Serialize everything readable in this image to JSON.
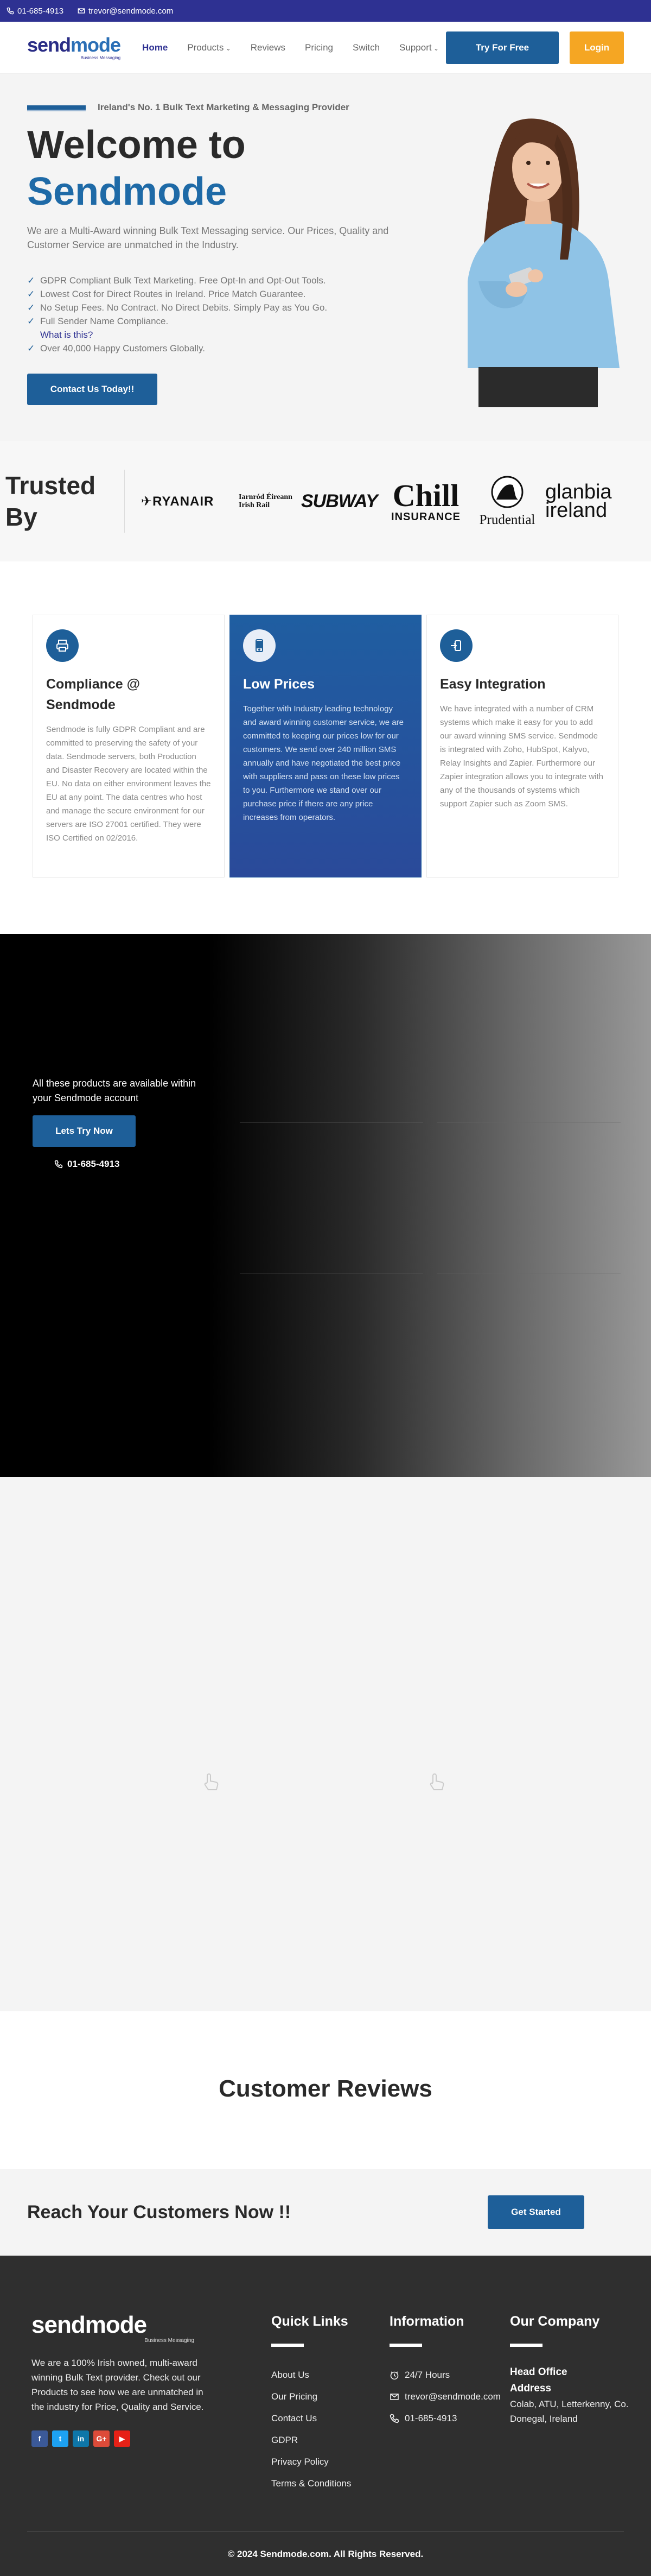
{
  "topbar": {
    "phone": "01-685-4913",
    "email": "trevor@sendmode.com"
  },
  "nav": {
    "logo": {
      "word_a": "send",
      "word_b": "mode",
      "tagline": "Business Messaging"
    },
    "items": [
      {
        "label": "Home",
        "active": true,
        "dropdown": false
      },
      {
        "label": "Products",
        "active": false,
        "dropdown": true
      },
      {
        "label": "Reviews",
        "active": false,
        "dropdown": false
      },
      {
        "label": "Pricing",
        "active": false,
        "dropdown": false
      },
      {
        "label": "Switch",
        "active": false,
        "dropdown": false
      },
      {
        "label": "Support",
        "active": false,
        "dropdown": true
      }
    ],
    "try_label": "Try For Free",
    "login_label": "Login"
  },
  "hero": {
    "subtitle": "Ireland's No. 1 Bulk Text Marketing & Messaging Provider",
    "title_line1": "Welcome to",
    "title_line2": "Sendmode",
    "description": "We are a Multi-Award winning Bulk Text Messaging service. Our Prices, Quality and Customer Service are unmatched in the Industry.",
    "list": [
      "GDPR Compliant Bulk Text Marketing. Free Opt-In and Opt-Out Tools.",
      "Lowest Cost for Direct Routes in Ireland. Price Match Guarantee.",
      "No Setup Fees. No Contract. No Direct Debits. Simply Pay as You Go.",
      "Full Sender Name Compliance.",
      "Over 40,000 Happy Customers Globally."
    ],
    "whatis": "What is this?",
    "contact_label": "Contact Us Today!!"
  },
  "trusted": {
    "title_line1": "Trusted",
    "title_line2": "By",
    "logos": {
      "ryanair": "RYANAIR",
      "irish_rail_1": "Iarnród Éireann",
      "irish_rail_2": "Irish Rail",
      "subway": "SUBWAY",
      "chill_1": "Chill",
      "chill_2": "INSURANCE",
      "prudential": "Prudential",
      "glanbia_1": "glanbia",
      "glanbia_2": "ireland"
    }
  },
  "features": [
    {
      "title": "Compliance @ Sendmode",
      "text": "Sendmode is fully GDPR Compliant and are committed to preserving the safety of your data. Sendmode servers, both Production and Disaster Recovery are located within the EU. No data on either environment leaves the EU at any point. The data centres who host and manage the secure environment for our servers are ISO 27001 certified. They were ISO Certified on 02/2016."
    },
    {
      "title": "Low Prices",
      "text": "Together with Industry leading technology and award winning customer service, we are committed to keeping our prices low for our customers. We send over 240 million SMS annually and have negotiated the best price with suppliers and pass on these low prices to you. Furthermore we stand over our purchase price if there are any price increases from operators."
    },
    {
      "title": "Easy Integration",
      "text": "We have integrated with a number of CRM systems which make it easy for you to add our award winning SMS service. Sendmode is integrated with Zoho, HubSpot, Kalyvo, Relay Insights and Zapier. Furthermore our Zapier integration allows you to integrate with any of the thousands of systems which support Zapier such as Zoom SMS."
    }
  ],
  "products": {
    "text": "All these products are available within your Sendmode account",
    "try_label": "Lets Try Now",
    "phone": "01-685-4913"
  },
  "reviews": {
    "title": "Customer Reviews"
  },
  "cta": {
    "title": "Reach Your Customers Now !!",
    "button": "Get Started"
  },
  "footer": {
    "about": "We are a 100% Irish owned, multi-award winning Bulk Text provider. Check out our Products to see how we are unmatched in the industry for Price, Quality and Service.",
    "socials": [
      {
        "icon": "facebook-icon",
        "glyph": "f",
        "color": "#3b5998"
      },
      {
        "icon": "twitter-icon",
        "glyph": "t",
        "color": "#1da1f2"
      },
      {
        "icon": "linkedin-icon",
        "glyph": "in",
        "color": "#0e76a8"
      },
      {
        "icon": "google-plus-icon",
        "glyph": "G+",
        "color": "#dd4b39"
      },
      {
        "icon": "youtube-icon",
        "glyph": "▶",
        "color": "#e62117"
      }
    ],
    "quicklinks_title": "Quick Links",
    "quicklinks": [
      "About Us",
      "Our Pricing",
      "Contact Us",
      "GDPR",
      "Privacy Policy",
      "Terms & Conditions"
    ],
    "info_title": "Information",
    "info": {
      "hours": "24/7 Hours",
      "email": "trevor@sendmode.com",
      "phone": "01-685-4913"
    },
    "company_title": "Our Company",
    "hq_title": "Head Office Address",
    "address": "Colab, ATU, Letterkenny, Co. Donegal, Ireland",
    "copyright": "© 2024 Sendmode.com. All Rights Reserved."
  }
}
